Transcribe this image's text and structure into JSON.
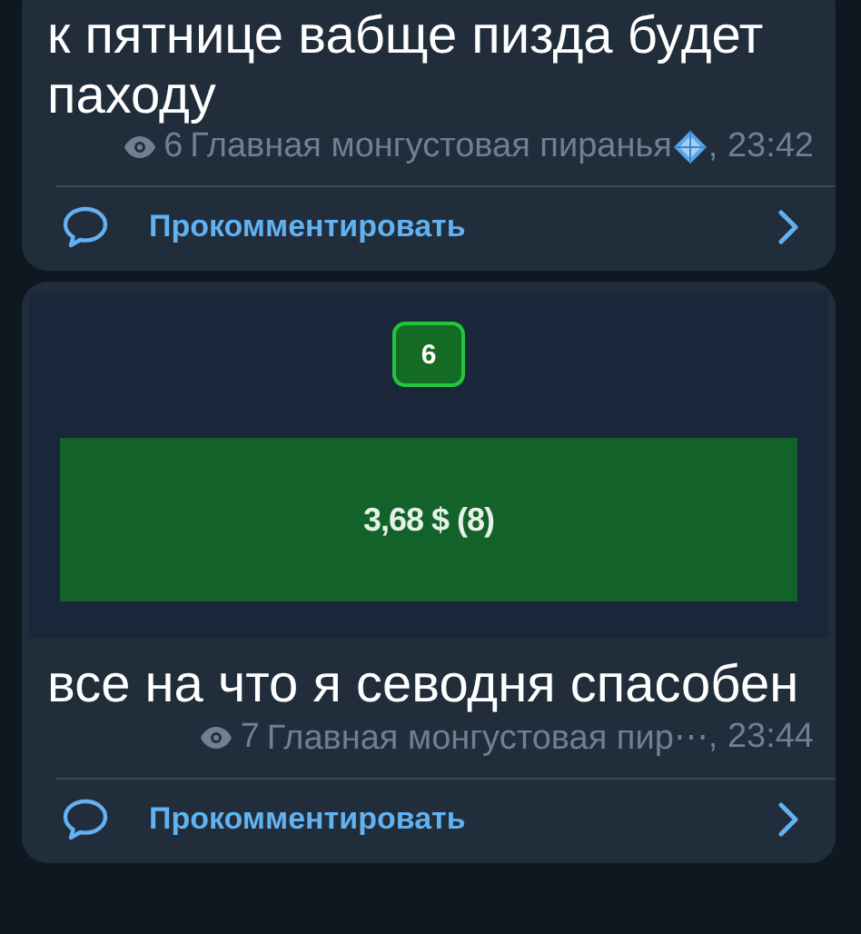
{
  "posts": [
    {
      "text": "к пятнице вабще пизда будет паходу",
      "views": "6",
      "author": "Главная монгустовая пиранья",
      "author_emoji": true,
      "time": ", 23:42",
      "comment_label": "Прокомментировать"
    },
    {
      "screenshot": {
        "badge": "6",
        "bar_label": "3,68 $ (8)"
      },
      "text": "все на что я севодня спасобен",
      "views": "7",
      "author": "Главная монгустовая пир⋯",
      "author_emoji": false,
      "time": ", 23:44",
      "comment_label": "Прокомментировать"
    }
  ]
}
